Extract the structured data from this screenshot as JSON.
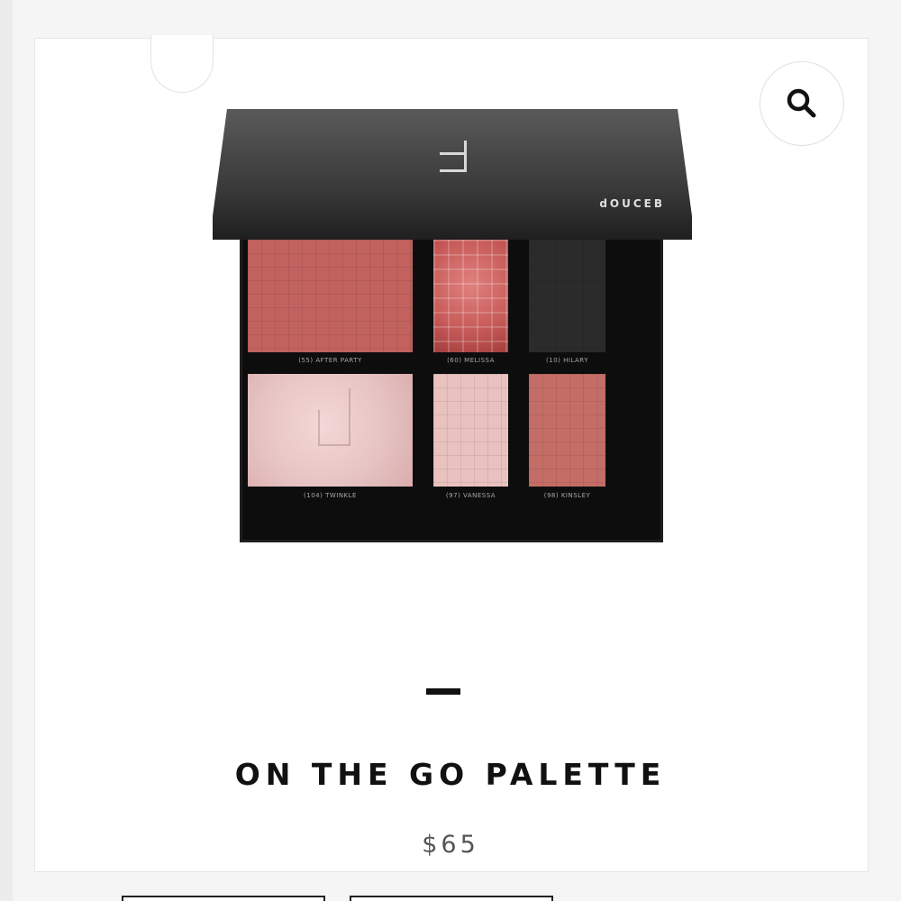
{
  "product": {
    "title": "ON THE GO PALETTE",
    "price": "$65",
    "brand_on_lid": "dOUCEB"
  },
  "palette_shades": [
    {
      "label": "(55) AFTER PARTY",
      "color": "#c2625f"
    },
    {
      "label": "(60) MELISSA",
      "color": "#c65a58"
    },
    {
      "label": "(10) HILARY",
      "color": "#2b2b2b"
    },
    {
      "label": "(104) TWINKLE",
      "color": "#e7c4c4"
    },
    {
      "label": "(97) VANESSA",
      "color": "#e9c2c0"
    },
    {
      "label": "(98) KINSLEY",
      "color": "#c46d66"
    }
  ],
  "icons": {
    "zoom": "search-icon"
  },
  "colors": {
    "text": "#111111",
    "price": "#555555",
    "card_border": "#e6e6e6"
  }
}
